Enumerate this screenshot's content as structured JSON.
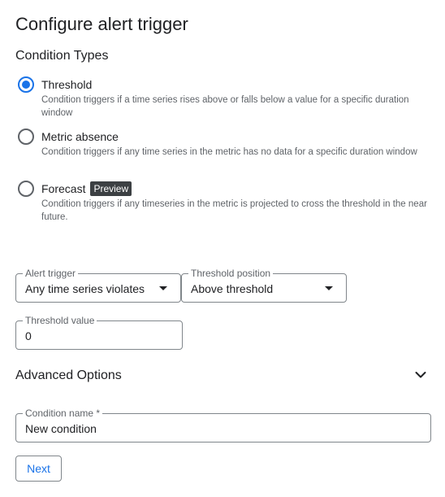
{
  "page": {
    "title": "Configure alert trigger",
    "section_title": "Condition Types"
  },
  "condition_types": [
    {
      "label": "Threshold",
      "description": "Condition triggers if a time series rises above or falls below a value for a specific duration window",
      "selected": true
    },
    {
      "label": "Metric absence",
      "description": "Condition triggers if any time series in the metric has no data for a specific duration window",
      "selected": false
    },
    {
      "label": "Forecast",
      "badge": "Preview",
      "description": "Condition triggers if any timeseries in the metric is projected to cross the threshold in the near future.",
      "selected": false
    }
  ],
  "alert_trigger": {
    "label": "Alert trigger",
    "value": "Any time series violates"
  },
  "threshold_position": {
    "label": "Threshold position",
    "value": "Above threshold"
  },
  "threshold_value": {
    "label": "Threshold value",
    "value": "0"
  },
  "advanced_options": {
    "label": "Advanced Options",
    "expanded": false
  },
  "condition_name": {
    "label": "Condition name *",
    "value": "New condition"
  },
  "next_button": {
    "label": "Next"
  },
  "colors": {
    "accent": "#1a73e8",
    "text": "#202124",
    "secondary_text": "#5f6368",
    "border": "#80868b",
    "badge_bg": "#3c4043"
  }
}
